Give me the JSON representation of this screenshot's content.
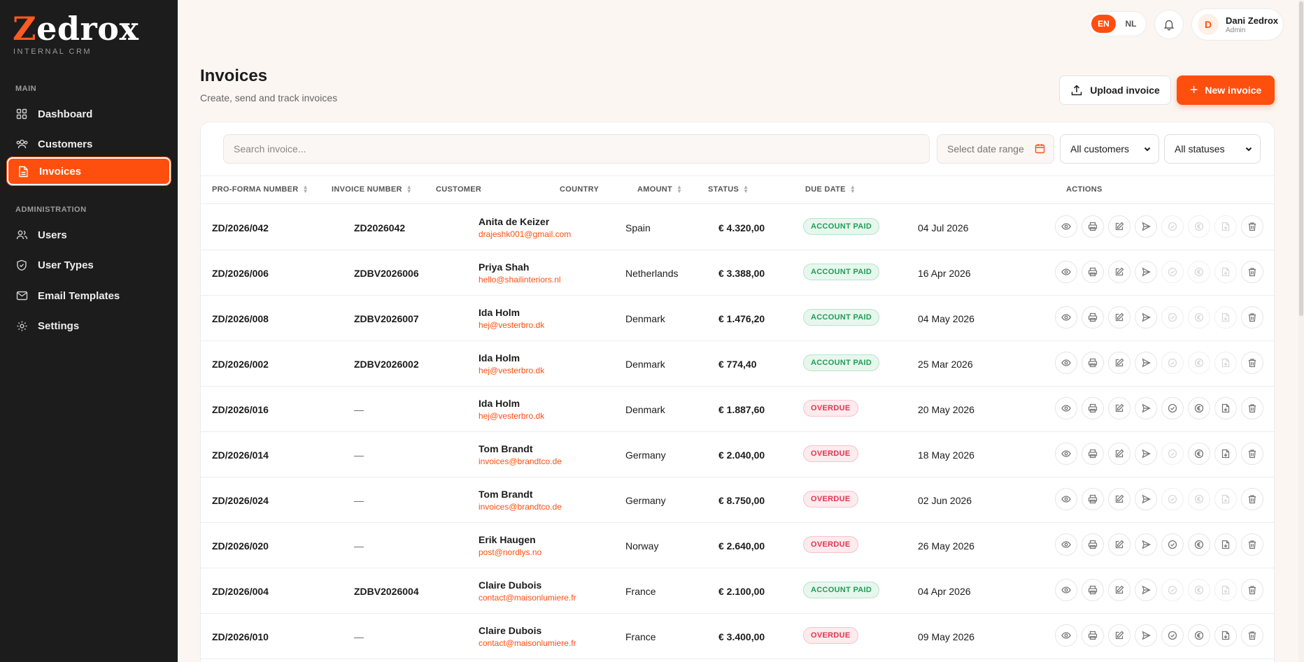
{
  "brand": {
    "logo_first": "Z",
    "logo_rest": "edrox",
    "subtitle": "INTERNAL CRM"
  },
  "sidebar": {
    "section_main": "MAIN",
    "section_admin": "ADMINISTRATION",
    "items": [
      {
        "label": "Dashboard",
        "icon": "grid-icon"
      },
      {
        "label": "Customers",
        "icon": "customers-icon"
      },
      {
        "label": "Invoices",
        "icon": "document-icon",
        "active": true
      },
      {
        "label": "Users",
        "icon": "users-icon"
      },
      {
        "label": "User Types",
        "icon": "shield-icon"
      },
      {
        "label": "Email Templates",
        "icon": "mail-icon"
      },
      {
        "label": "Settings",
        "icon": "gear-icon"
      }
    ]
  },
  "topbar": {
    "lang_en": "EN",
    "lang_nl": "NL",
    "user_initial": "D",
    "user_name": "Dani Zedrox",
    "user_role": "Admin"
  },
  "page": {
    "title": "Invoices",
    "subtitle": "Create, send and track invoices",
    "upload_label": "Upload invoice",
    "new_label": "New invoice"
  },
  "filters": {
    "search_placeholder": "Search invoice...",
    "date_range": "Select date range",
    "customers": "All customers",
    "statuses": "All statuses"
  },
  "table": {
    "headers": {
      "proforma": "PRO-FORMA NUMBER",
      "invoice": "INVOICE NUMBER",
      "customer": "CUSTOMER",
      "country": "COUNTRY",
      "amount": "AMOUNT",
      "status": "STATUS",
      "due": "DUE DATE",
      "actions": "ACTIONS"
    },
    "rows": [
      {
        "proforma": "ZD/2026/042",
        "invoice": "ZD2026042",
        "name": "Anita de Keizer",
        "email": "drajeshk001@gmail.com",
        "country": "Spain",
        "amount": "€ 4.320,00",
        "status": "ACCOUNT PAID",
        "due": "04 Jul 2026"
      },
      {
        "proforma": "ZD/2026/006",
        "invoice": "ZDBV2026006",
        "name": "Priya Shah",
        "email": "hello@shailinteriors.nl",
        "country": "Netherlands",
        "amount": "€ 3.388,00",
        "status": "ACCOUNT PAID",
        "due": "16 Apr 2026"
      },
      {
        "proforma": "ZD/2026/008",
        "invoice": "ZDBV2026007",
        "name": "Ida Holm",
        "email": "hej@vesterbro.dk",
        "country": "Denmark",
        "amount": "€ 1.476,20",
        "status": "ACCOUNT PAID",
        "due": "04 May 2026"
      },
      {
        "proforma": "ZD/2026/002",
        "invoice": "ZDBV2026002",
        "name": "Ida Holm",
        "email": "hej@vesterbro.dk",
        "country": "Denmark",
        "amount": "€ 774,40",
        "status": "ACCOUNT PAID",
        "due": "25 Mar 2026"
      },
      {
        "proforma": "ZD/2026/016",
        "invoice": "—",
        "name": "Ida Holm",
        "email": "hej@vesterbro.dk",
        "country": "Denmark",
        "amount": "€ 1.887,60",
        "status": "OVERDUE",
        "due": "20 May 2026"
      },
      {
        "proforma": "ZD/2026/014",
        "invoice": "—",
        "name": "Tom Brandt",
        "email": "invoices@brandtco.de",
        "country": "Germany",
        "amount": "€ 2.040,00",
        "status": "OVERDUE",
        "due": "18 May 2026"
      },
      {
        "proforma": "ZD/2026/024",
        "invoice": "—",
        "name": "Tom Brandt",
        "email": "invoices@brandtco.de",
        "country": "Germany",
        "amount": "€ 8.750,00",
        "status": "OVERDUE",
        "due": "02 Jun 2026"
      },
      {
        "proforma": "ZD/2026/020",
        "invoice": "—",
        "name": "Erik Haugen",
        "email": "post@nordlys.no",
        "country": "Norway",
        "amount": "€ 2.640,00",
        "status": "OVERDUE",
        "due": "26 May 2026"
      },
      {
        "proforma": "ZD/2026/004",
        "invoice": "ZDBV2026004",
        "name": "Claire Dubois",
        "email": "contact@maisonlumiere.fr",
        "country": "France",
        "amount": "€ 2.100,00",
        "status": "ACCOUNT PAID",
        "due": "04 Apr 2026"
      },
      {
        "proforma": "ZD/2026/010",
        "invoice": "—",
        "name": "Claire Dubois",
        "email": "contact@maisonlumiere.fr",
        "country": "France",
        "amount": "€ 3.400,00",
        "status": "OVERDUE",
        "due": "09 May 2026"
      }
    ]
  },
  "colors": {
    "accent": "#ff4f0f",
    "sidebar": "#1c1c1c",
    "paid": "#1f9d55",
    "overdue": "#e0344f"
  }
}
